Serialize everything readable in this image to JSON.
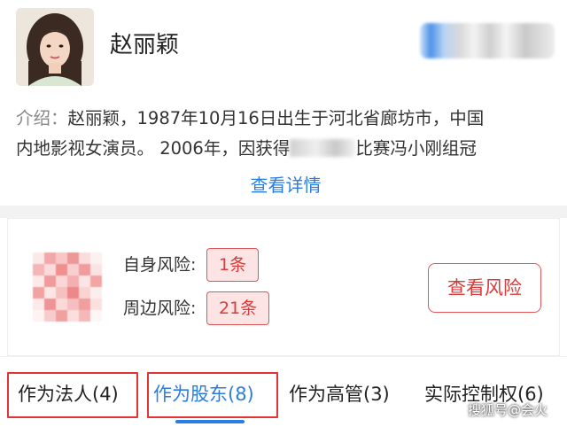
{
  "profile": {
    "name": "赵丽颖",
    "intro_label": "介绍：",
    "intro_line1": "赵丽颖，1987年10月16日出生于河北省廊坊市，中国",
    "intro_line2_a": "内地影视女演员。 2006年，因获得",
    "intro_line2_b": "比赛冯小刚组冠",
    "detail_link": "查看详情"
  },
  "risk": {
    "self_label": "自身风险:",
    "self_count": "1条",
    "surround_label": "周边风险:",
    "surround_count": "21条",
    "button_label": "查看风险",
    "accent_color": "#d93a3a"
  },
  "tabs": [
    {
      "label": "作为法人(4)",
      "highlighted": true,
      "active": false
    },
    {
      "label": "作为股东(8)",
      "highlighted": true,
      "active": true
    },
    {
      "label": "作为高管(3)",
      "highlighted": false,
      "active": false
    },
    {
      "label": "实际控制权(6)",
      "highlighted": false,
      "active": false
    }
  ],
  "watermark": "搜狐号@会火",
  "colors": {
    "link_blue": "#2a7de1",
    "highlight_red": "#e23434"
  }
}
